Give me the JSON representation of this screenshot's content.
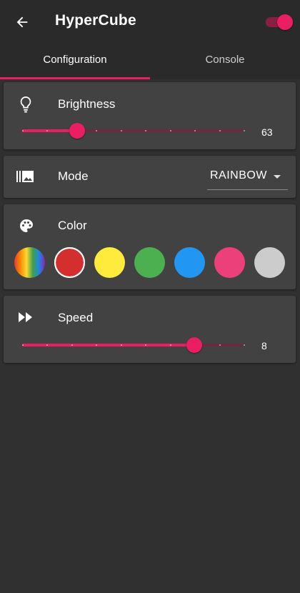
{
  "appbar": {
    "title": "HyperCube",
    "back_icon": "arrow-left-icon",
    "power_switch_on": true
  },
  "tabs": [
    {
      "label": "Configuration",
      "active": true
    },
    {
      "label": "Console",
      "active": false
    }
  ],
  "cards": {
    "brightness": {
      "icon": "lightbulb-icon",
      "label": "Brightness",
      "value": 63,
      "min": 0,
      "max": 255,
      "display": "63"
    },
    "mode": {
      "icon": "gallery-icon",
      "label": "Mode",
      "selected": "RAINBOW"
    },
    "color": {
      "icon": "palette-icon",
      "label": "Color",
      "swatches": [
        {
          "name": "rainbow",
          "color": "rainbow",
          "selected": false
        },
        {
          "name": "red",
          "color": "#d32f2f",
          "selected": true
        },
        {
          "name": "yellow",
          "color": "#ffeb3b",
          "selected": false
        },
        {
          "name": "green",
          "color": "#4caf50",
          "selected": false
        },
        {
          "name": "blue",
          "color": "#2196f3",
          "selected": false
        },
        {
          "name": "pink",
          "color": "#ec407a",
          "selected": false
        },
        {
          "name": "grey",
          "color": "#cccccc",
          "selected": false
        }
      ]
    },
    "speed": {
      "icon": "fast-forward-icon",
      "label": "Speed",
      "value": 8,
      "min": 1,
      "max": 10,
      "display": "8"
    }
  },
  "accent": "#e91e63"
}
